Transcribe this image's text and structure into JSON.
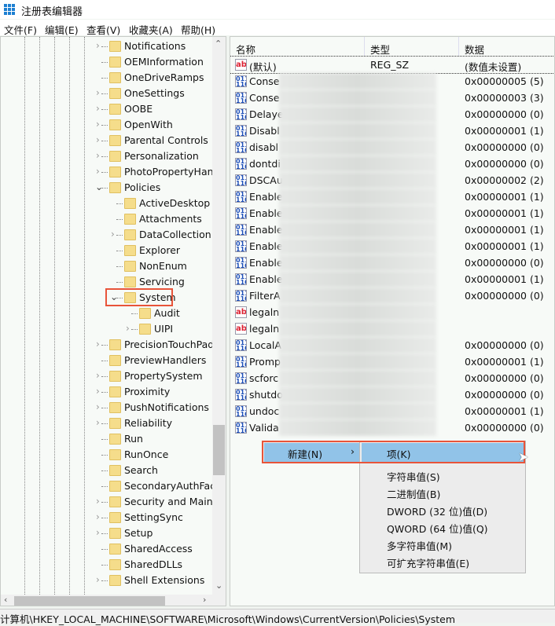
{
  "window": {
    "title": "注册表编辑器"
  },
  "menubar": [
    "文件(F)",
    "编辑(E)",
    "查看(V)",
    "收藏夹(A)",
    "帮助(H)"
  ],
  "tree": [
    {
      "label": "Notifications",
      "level": 1,
      "expand": true
    },
    {
      "label": "OEMInformation",
      "level": 1,
      "expand": false
    },
    {
      "label": "OneDriveRamps",
      "level": 1,
      "expand": false
    },
    {
      "label": "OneSettings",
      "level": 1,
      "expand": true
    },
    {
      "label": "OOBE",
      "level": 1,
      "expand": true
    },
    {
      "label": "OpenWith",
      "level": 1,
      "expand": true
    },
    {
      "label": "Parental Controls",
      "level": 1,
      "expand": true
    },
    {
      "label": "Personalization",
      "level": 1,
      "expand": true
    },
    {
      "label": "PhotoPropertyHand",
      "level": 1,
      "expand": true
    },
    {
      "label": "Policies",
      "level": 1,
      "expand": "open"
    },
    {
      "label": "ActiveDesktop",
      "level": 2,
      "expand": false
    },
    {
      "label": "Attachments",
      "level": 2,
      "expand": false
    },
    {
      "label": "DataCollection",
      "level": 2,
      "expand": true
    },
    {
      "label": "Explorer",
      "level": 2,
      "expand": false
    },
    {
      "label": "NonEnum",
      "level": 2,
      "expand": false
    },
    {
      "label": "Servicing",
      "level": 2,
      "expand": false
    },
    {
      "label": "System",
      "level": 2,
      "expand": "open",
      "selected": true
    },
    {
      "label": "Audit",
      "level": 3,
      "expand": false
    },
    {
      "label": "UIPI",
      "level": 3,
      "expand": true
    },
    {
      "label": "PrecisionTouchPad",
      "level": 1,
      "expand": true
    },
    {
      "label": "PreviewHandlers",
      "level": 1,
      "expand": false
    },
    {
      "label": "PropertySystem",
      "level": 1,
      "expand": true
    },
    {
      "label": "Proximity",
      "level": 1,
      "expand": true
    },
    {
      "label": "PushNotifications",
      "level": 1,
      "expand": true
    },
    {
      "label": "Reliability",
      "level": 1,
      "expand": true
    },
    {
      "label": "Run",
      "level": 1,
      "expand": false
    },
    {
      "label": "RunOnce",
      "level": 1,
      "expand": false
    },
    {
      "label": "Search",
      "level": 1,
      "expand": false
    },
    {
      "label": "SecondaryAuthFacto",
      "level": 1,
      "expand": false
    },
    {
      "label": "Security and Mainte",
      "level": 1,
      "expand": true
    },
    {
      "label": "SettingSync",
      "level": 1,
      "expand": true
    },
    {
      "label": "Setup",
      "level": 1,
      "expand": true
    },
    {
      "label": "SharedAccess",
      "level": 1,
      "expand": false
    },
    {
      "label": "SharedDLLs",
      "level": 1,
      "expand": false
    },
    {
      "label": "Shell Extensions",
      "level": 1,
      "expand": true
    }
  ],
  "list": {
    "headers": [
      "名称",
      "类型",
      "数据"
    ],
    "rows": [
      {
        "icon": "string-value-icon",
        "name": "(默认)",
        "type": "REG_SZ",
        "data": "(数值未设置)",
        "blur": false
      },
      {
        "icon": "binary-value-icon",
        "name": "Conse",
        "type": "",
        "data": "0x00000005 (5)",
        "blur": true
      },
      {
        "icon": "binary-value-icon",
        "name": "Conse",
        "type": "",
        "data": "0x00000003 (3)",
        "blur": true
      },
      {
        "icon": "binary-value-icon",
        "name": "Delaye",
        "type": "",
        "data": "0x00000000 (0)",
        "blur": true
      },
      {
        "icon": "binary-value-icon",
        "name": "Disabl",
        "type": "",
        "data": "0x00000001 (1)",
        "blur": true
      },
      {
        "icon": "binary-value-icon",
        "name": "disabl",
        "type": "",
        "data": "0x00000000 (0)",
        "blur": true
      },
      {
        "icon": "binary-value-icon",
        "name": "dontdi",
        "type": "",
        "data": "0x00000000 (0)",
        "blur": true
      },
      {
        "icon": "binary-value-icon",
        "name": "DSCAu",
        "type": "",
        "data": "0x00000002 (2)",
        "blur": true
      },
      {
        "icon": "binary-value-icon",
        "name": "Enable",
        "type": "",
        "data": "0x00000001 (1)",
        "blur": true
      },
      {
        "icon": "binary-value-icon",
        "name": "Enable",
        "type": "",
        "data": "0x00000001 (1)",
        "blur": true
      },
      {
        "icon": "binary-value-icon",
        "name": "Enable",
        "type": "",
        "data": "0x00000001 (1)",
        "blur": true
      },
      {
        "icon": "binary-value-icon",
        "name": "Enable",
        "type": "",
        "data": "0x00000001 (1)",
        "blur": true
      },
      {
        "icon": "binary-value-icon",
        "name": "Enable",
        "type": "",
        "data": "0x00000000 (0)",
        "blur": true
      },
      {
        "icon": "binary-value-icon",
        "name": "Enable",
        "type": "",
        "data": "0x00000001 (1)",
        "blur": true
      },
      {
        "icon": "binary-value-icon",
        "name": "FilterA",
        "type": "",
        "data": "0x00000000 (0)",
        "blur": true
      },
      {
        "icon": "string-value-icon",
        "name": "legaln",
        "type": "",
        "data": "",
        "blur": true
      },
      {
        "icon": "string-value-icon",
        "name": "legaln",
        "type": "",
        "data": "",
        "blur": true
      },
      {
        "icon": "binary-value-icon",
        "name": "LocalA",
        "type": "",
        "data": "0x00000000 (0)",
        "blur": true
      },
      {
        "icon": "binary-value-icon",
        "name": "Promp",
        "type": "",
        "data": "0x00000001 (1)",
        "blur": true
      },
      {
        "icon": "binary-value-icon",
        "name": "scforc",
        "type": "",
        "data": "0x00000000 (0)",
        "blur": true
      },
      {
        "icon": "binary-value-icon",
        "name": "shutdo",
        "type": "",
        "data": "0x00000000 (0)",
        "blur": true
      },
      {
        "icon": "binary-value-icon",
        "name": "undoc",
        "type": "",
        "data": "0x00000001 (1)",
        "blur": true
      },
      {
        "icon": "binary-value-icon",
        "name": "Valida",
        "type": "",
        "data": "0x00000000 (0)",
        "blur": true
      }
    ]
  },
  "context_menu": {
    "new_label": "新建(N)",
    "submenu_arrow": "›"
  },
  "submenu": [
    "项(K)",
    "字符串值(S)",
    "二进制值(B)",
    "DWORD (32 位)值(D)",
    "QWORD (64 位)值(Q)",
    "多字符串值(M)",
    "可扩充字符串值(E)"
  ],
  "status": {
    "path": "计算机\\HKEY_LOCAL_MACHINE\\SOFTWARE\\Microsoft\\Windows\\CurrentVersion\\Policies\\System"
  },
  "colors": {
    "highlight": "#e8543a",
    "menu_selected": "#91c3e8",
    "folder": "#f5dd8b"
  }
}
